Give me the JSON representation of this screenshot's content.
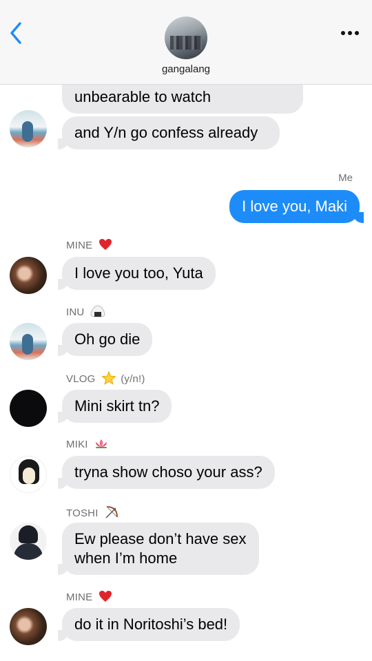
{
  "header": {
    "group_name": "gangalang"
  },
  "messages": {
    "partial_top": "unbearable to watch",
    "m_inu_1": "and Y/n go confess already",
    "me_label": "Me",
    "m_me": "I love you, Maki",
    "s_mine_1": "MINE",
    "m_mine_1": "I love you too, Yuta",
    "s_inu": "INU",
    "m_inu_2": "Oh go die",
    "s_vlog": "VLOG",
    "s_vlog_extra": "(y/n!)",
    "m_vlog": "Mini skirt tn?",
    "s_miki": "MIKI",
    "m_miki": "tryna show choso your ass?",
    "s_toshi": "TOSHI",
    "m_toshi_1": "Ew please don’t have sex",
    "m_toshi_2": "when I’m home",
    "s_mine_2": "MINE",
    "m_mine_2": "do it in Noritoshi’s bed!"
  },
  "icons": {
    "mine": "red-heart-icon",
    "inu": "rice-ball-icon",
    "vlog": "star-icon",
    "miki": "lotus-icon",
    "toshi": "bow-and-arrow-icon"
  },
  "colors": {
    "accent": "#1d8cf8",
    "incoming_bubble": "#e9e9eb"
  }
}
